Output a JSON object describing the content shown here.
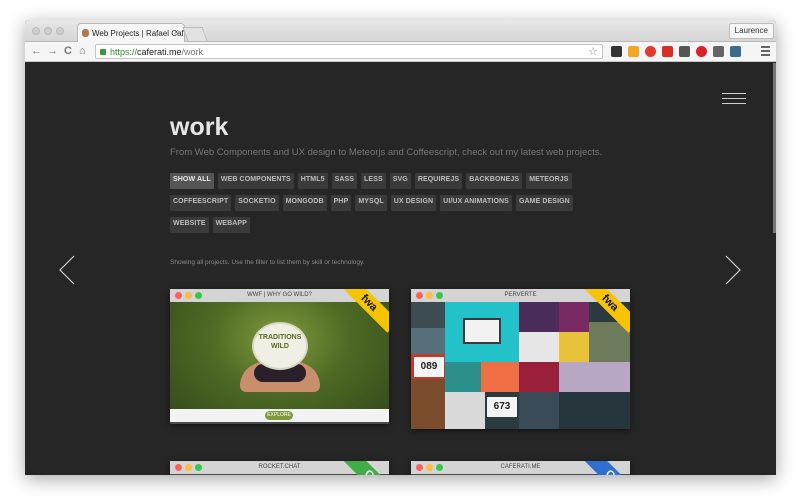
{
  "browser": {
    "tab_title": "Web Projects | Rafael Cafera",
    "user": "Laurence",
    "url": {
      "scheme": "https://",
      "host": "caferati.me",
      "path": "/work"
    },
    "nav": {
      "back": "←",
      "forward": "→",
      "reload": "C",
      "home": "⌂"
    },
    "star": "☆"
  },
  "page": {
    "title": "work",
    "subtitle": "From Web Components and UX design to Meteorjs and Coffeescript, check out my latest web projects.",
    "filters": [
      "SHOW ALL",
      "WEB COMPONENTS",
      "HTML5",
      "SASS",
      "LESS",
      "SVG",
      "REQUIREJS",
      "BACKBONEJS",
      "METEORJS",
      "COFFEESCRIPT",
      "SOCKETIO",
      "MONGODB",
      "PHP",
      "MYSQL",
      "UX DESIGN",
      "UI/UX ANIMATIONS",
      "GAME DESIGN",
      "WEBSITE",
      "WEBAPP"
    ],
    "active_filter": "SHOW ALL",
    "note": "Showing all projects. Use the filter to list them by skill or technology.",
    "projects": [
      {
        "title": "WWF | WHY GO WILD?",
        "ribbon": "fwa",
        "ribbon_color": "#f6c400",
        "badge": "TRADITIONS WILD",
        "explore": "EXPLORE"
      },
      {
        "title": "PERVERTE",
        "ribbon": "fwa",
        "ribbon_color": "#f6c400",
        "digits_a": "089",
        "digits_b": "673"
      },
      {
        "title": "ROCKET.CHAT",
        "ribbon": "G",
        "ribbon_color": "#3fae49"
      },
      {
        "title": "CAFERATI.ME",
        "ribbon": "G",
        "ribbon_color": "#2f6fd1"
      }
    ]
  },
  "colors": {
    "page_bg": "#262626",
    "chip_bg": "#3a3a3a",
    "chip_text": "#bdbdbd",
    "title_text": "#e6e6e6",
    "traffic_red": "#fc605c",
    "traffic_yellow": "#fdbc40",
    "traffic_green": "#34c84a"
  },
  "icons": {
    "prev_arrow": "chevron-left-icon",
    "next_arrow": "chevron-right-icon",
    "menu": "hamburger-icon"
  }
}
